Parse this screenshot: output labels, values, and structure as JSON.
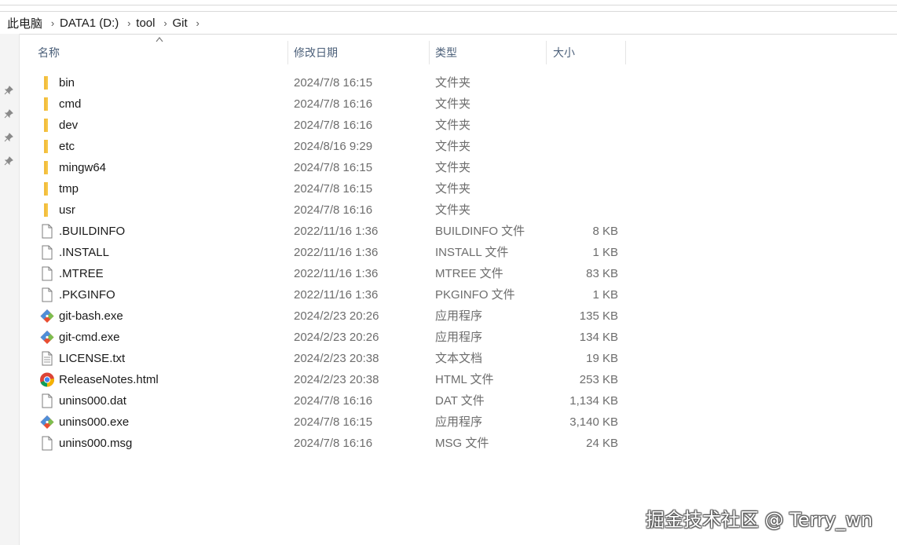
{
  "breadcrumb": [
    {
      "label": "此电脑"
    },
    {
      "label": "DATA1 (D:)"
    },
    {
      "label": "tool"
    },
    {
      "label": "Git"
    }
  ],
  "columns": {
    "name": "名称",
    "date": "修改日期",
    "type": "类型",
    "size": "大小"
  },
  "files": [
    {
      "name": "bin",
      "date": "2024/7/8 16:15",
      "type": "文件夹",
      "size": "",
      "icon": "folder-icon"
    },
    {
      "name": "cmd",
      "date": "2024/7/8 16:16",
      "type": "文件夹",
      "size": "",
      "icon": "folder-icon"
    },
    {
      "name": "dev",
      "date": "2024/7/8 16:16",
      "type": "文件夹",
      "size": "",
      "icon": "folder-icon"
    },
    {
      "name": "etc",
      "date": "2024/8/16 9:29",
      "type": "文件夹",
      "size": "",
      "icon": "folder-icon"
    },
    {
      "name": "mingw64",
      "date": "2024/7/8 16:15",
      "type": "文件夹",
      "size": "",
      "icon": "folder-icon"
    },
    {
      "name": "tmp",
      "date": "2024/7/8 16:15",
      "type": "文件夹",
      "size": "",
      "icon": "folder-icon"
    },
    {
      "name": "usr",
      "date": "2024/7/8 16:16",
      "type": "文件夹",
      "size": "",
      "icon": "folder-icon"
    },
    {
      "name": ".BUILDINFO",
      "date": "2022/11/16 1:36",
      "type": "BUILDINFO 文件",
      "size": "8 KB",
      "icon": "file-icon"
    },
    {
      "name": ".INSTALL",
      "date": "2022/11/16 1:36",
      "type": "INSTALL 文件",
      "size": "1 KB",
      "icon": "file-icon"
    },
    {
      "name": ".MTREE",
      "date": "2022/11/16 1:36",
      "type": "MTREE 文件",
      "size": "83 KB",
      "icon": "file-icon"
    },
    {
      "name": ".PKGINFO",
      "date": "2022/11/16 1:36",
      "type": "PKGINFO 文件",
      "size": "1 KB",
      "icon": "file-icon"
    },
    {
      "name": "git-bash.exe",
      "date": "2024/2/23 20:26",
      "type": "应用程序",
      "size": "135 KB",
      "icon": "git-icon"
    },
    {
      "name": "git-cmd.exe",
      "date": "2024/2/23 20:26",
      "type": "应用程序",
      "size": "134 KB",
      "icon": "git-icon"
    },
    {
      "name": "LICENSE.txt",
      "date": "2024/2/23 20:38",
      "type": "文本文档",
      "size": "19 KB",
      "icon": "text-file-icon"
    },
    {
      "name": "ReleaseNotes.html",
      "date": "2024/2/23 20:38",
      "type": "HTML 文件",
      "size": "253 KB",
      "icon": "chrome-icon"
    },
    {
      "name": "unins000.dat",
      "date": "2024/7/8 16:16",
      "type": "DAT 文件",
      "size": "1,134 KB",
      "icon": "file-icon"
    },
    {
      "name": "unins000.exe",
      "date": "2024/7/8 16:15",
      "type": "应用程序",
      "size": "3,140 KB",
      "icon": "git-icon"
    },
    {
      "name": "unins000.msg",
      "date": "2024/7/8 16:16",
      "type": "MSG 文件",
      "size": "24 KB",
      "icon": "file-icon"
    }
  ],
  "watermark": "掘金技术社区 @ Terry_wn",
  "colors": {
    "folder": "#f7c948",
    "column_header_text": "#4c607a",
    "secondary_text": "#6d6d6d"
  }
}
